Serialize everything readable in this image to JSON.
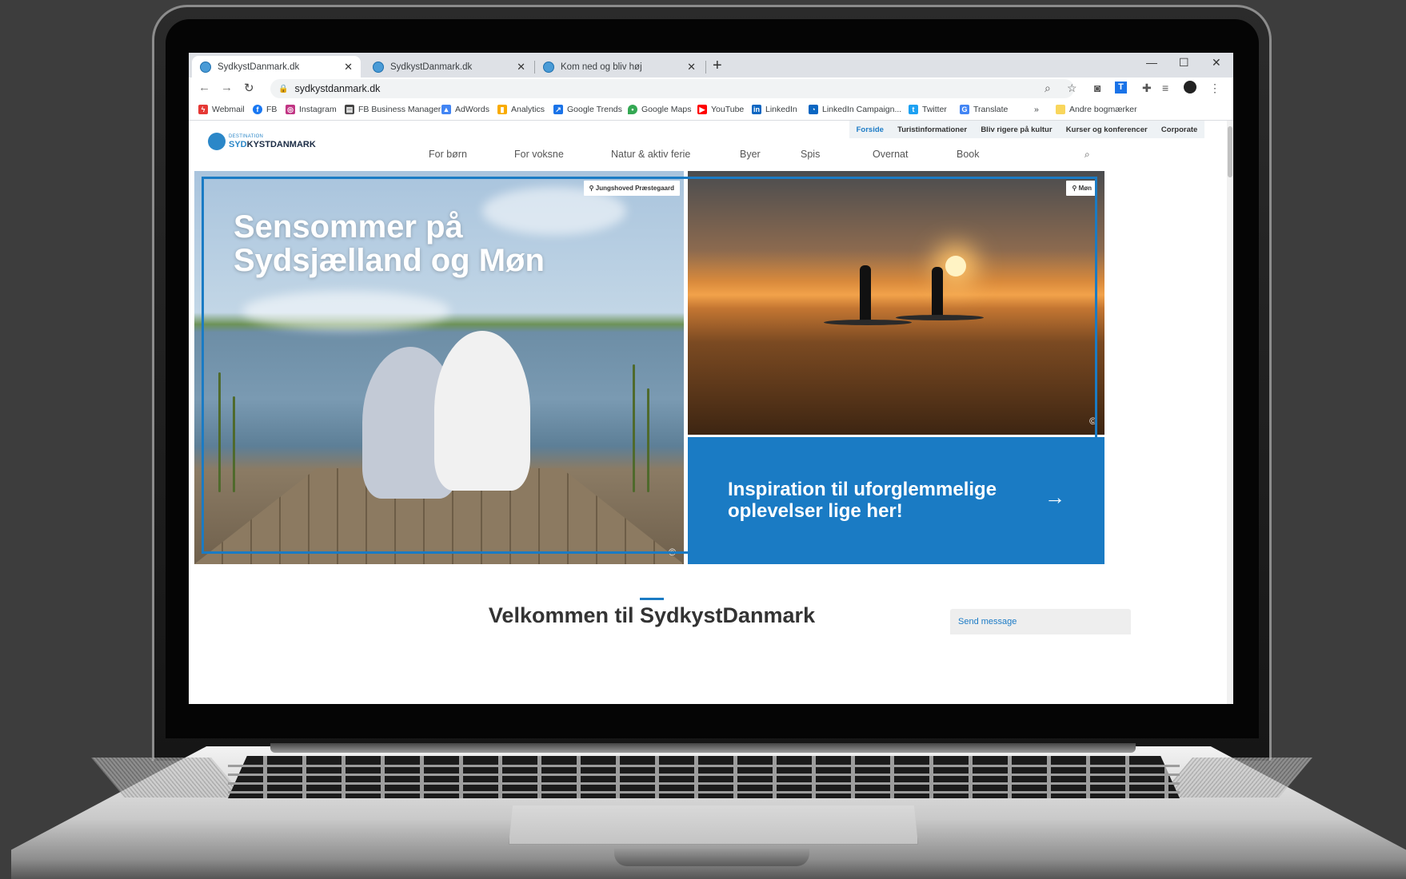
{
  "browser": {
    "tabs": [
      {
        "title": "SydkystDanmark.dk",
        "close": "✕"
      },
      {
        "title": "SydkystDanmark.dk",
        "close": "✕"
      },
      {
        "title": "Kom ned og bliv høj",
        "close": "✕"
      }
    ],
    "new_tab": "+",
    "window_controls": {
      "minimize": "—",
      "maximize": "☐",
      "close": "✕"
    },
    "url": "sydkystdanmark.dk",
    "bookmarks": [
      {
        "label": "Webmail",
        "icon": "webmail-icon",
        "color": "#e53935"
      },
      {
        "label": "FB",
        "icon": "facebook-icon",
        "color": "#1877f2"
      },
      {
        "label": "Instagram",
        "icon": "instagram-icon",
        "color": "#c13584"
      },
      {
        "label": "FB Business Manager",
        "icon": "business-manager-icon",
        "color": "#444444"
      },
      {
        "label": "AdWords",
        "icon": "adwords-icon",
        "color": "#4285f4"
      },
      {
        "label": "Analytics",
        "icon": "analytics-icon",
        "color": "#f9ab00"
      },
      {
        "label": "Google Trends",
        "icon": "trends-icon",
        "color": "#1a73e8"
      },
      {
        "label": "Google Maps",
        "icon": "maps-icon",
        "color": "#34a853"
      },
      {
        "label": "YouTube",
        "icon": "youtube-icon",
        "color": "#ff0000"
      },
      {
        "label": "LinkedIn",
        "icon": "linkedin-icon",
        "color": "#0a66c2"
      },
      {
        "label": "LinkedIn Campaign...",
        "icon": "linkedin-campaign-icon",
        "color": "#0a66c2"
      },
      {
        "label": "Twitter",
        "icon": "twitter-icon",
        "color": "#1da1f2"
      },
      {
        "label": "Translate",
        "icon": "translate-icon",
        "color": "#4285f4"
      }
    ],
    "bookmarks_more": "»",
    "other_bookmarks": "Andre bogmærker"
  },
  "site": {
    "top_nav": [
      "Forside",
      "Turistinformationer",
      "Bliv rigere på kultur",
      "Kurser og konferencer",
      "Corporate"
    ],
    "logo_small": "DESTINATION",
    "logo_big_a": "SYD",
    "logo_big_b": "KYSTDANMARK",
    "main_nav": [
      "For børn",
      "For voksne",
      "Natur & aktiv ferie",
      "Byer",
      "Spis",
      "Overnat",
      "Book"
    ],
    "hero_title": "Sensommer på Sydsjælland og Møn",
    "hero_left_location": "Jungshoved Præstegaard",
    "hero_right_location": "Møn",
    "copyright_symbol": "©",
    "cta_text": "Inspiration til uforglemmelige oplevelser lige her!",
    "cta_arrow": "→",
    "welcome_heading": "Velkommen til SydkystDanmark",
    "chat_label": "Send message",
    "accent_color": "#1a7bc4"
  }
}
